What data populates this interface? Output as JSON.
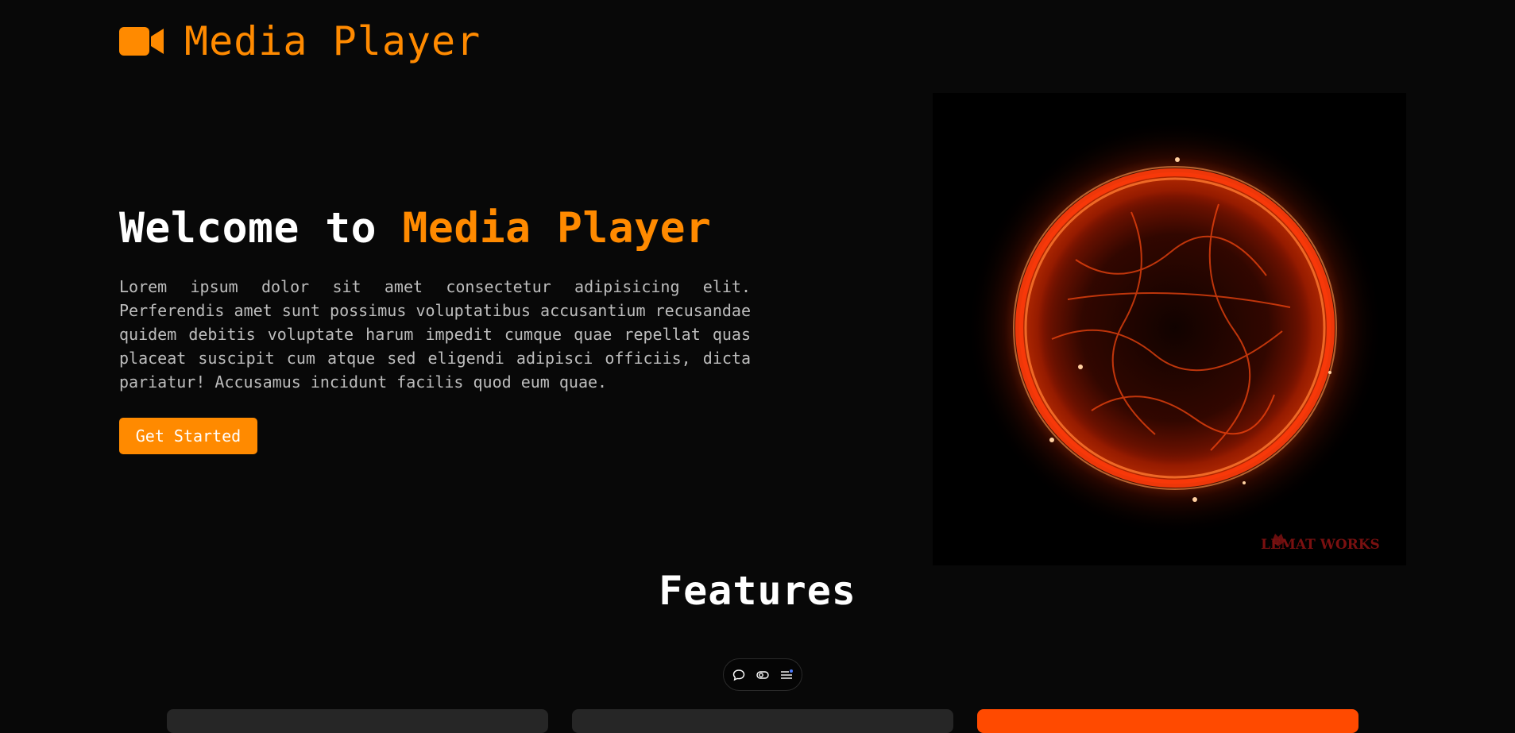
{
  "header": {
    "logo_icon": "video-camera-icon",
    "logo_text": "Media Player",
    "accent_color": "#ff8a00"
  },
  "hero": {
    "title_prefix": "Welcome to ",
    "title_accent": "Media Player",
    "description": "Lorem ipsum dolor sit amet consectetur adipisicing elit. Perferendis amet sunt possimus voluptatibus accusantium recusandae quidem debitis voluptate harum impedit cumque quae repellat quas placeat suscipit cum atque sed eligendi adipisci officiis, dicta pariatur! Accusamus incidunt facilis quod eum quae.",
    "cta_label": "Get Started",
    "image_watermark": "LEMAT WORKS"
  },
  "features": {
    "title": "Features",
    "toolbar_icons": [
      "chat-bubble-icon",
      "eye-toggle-icon",
      "menu-list-icon"
    ],
    "card_colors": [
      "#262626",
      "#262626",
      "#ff4a00"
    ]
  }
}
